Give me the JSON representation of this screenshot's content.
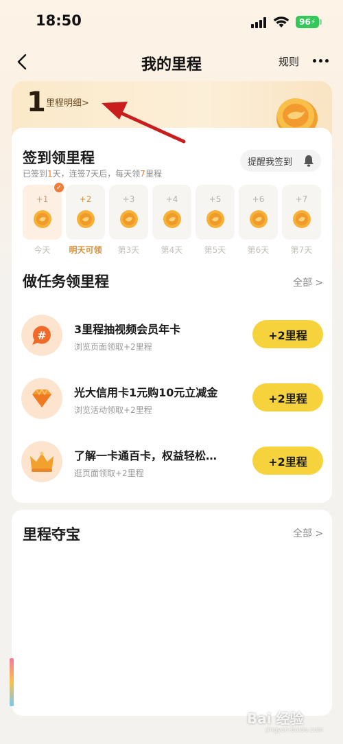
{
  "status_bar": {
    "time": "18:50",
    "battery": "96"
  },
  "nav": {
    "title": "我的里程",
    "rules": "规则"
  },
  "mileage": {
    "count": "1",
    "detail_link": "里程明细>"
  },
  "signin": {
    "title": "签到领里程",
    "subtitle_parts": [
      "已签到",
      "1",
      "天，连签7天后，每天领",
      "7",
      "里程"
    ],
    "remind_button": "提醒我签到",
    "days": [
      {
        "plus": "+1",
        "label": "今天",
        "state": "checked"
      },
      {
        "plus": "+2",
        "label": "明天可领",
        "state": "next"
      },
      {
        "plus": "+3",
        "label": "第3天",
        "state": "future"
      },
      {
        "plus": "+4",
        "label": "第4天",
        "state": "future"
      },
      {
        "plus": "+5",
        "label": "第5天",
        "state": "future"
      },
      {
        "plus": "+6",
        "label": "第6天",
        "state": "future"
      },
      {
        "plus": "+7",
        "label": "第7天",
        "state": "future"
      }
    ]
  },
  "tasks": {
    "title": "做任务领里程",
    "all_link": "全部 >",
    "items": [
      {
        "title": "3里程抽视频会员年卡",
        "subtitle": "浏览页面领取+2里程",
        "button": "+2里程",
        "icon": "hashtag-bubble-icon"
      },
      {
        "title": "光大信用卡1元购10元立减金",
        "subtitle": "浏览活动领取+2里程",
        "button": "+2里程",
        "icon": "diamond-icon"
      },
      {
        "title": "了解一卡通百卡，权益轻松…",
        "subtitle": "逛页面领取+2里程",
        "button": "+2里程",
        "icon": "crown-icon"
      }
    ]
  },
  "treasure": {
    "title": "里程夺宝",
    "all_link": "全部 >"
  },
  "colors": {
    "accent_orange": "#e8762a",
    "button_yellow": "#f6d33c",
    "battery_green": "#34c759"
  },
  "watermark": {
    "text": "Bai 经验",
    "sub": "jingyan.baidu.com"
  }
}
